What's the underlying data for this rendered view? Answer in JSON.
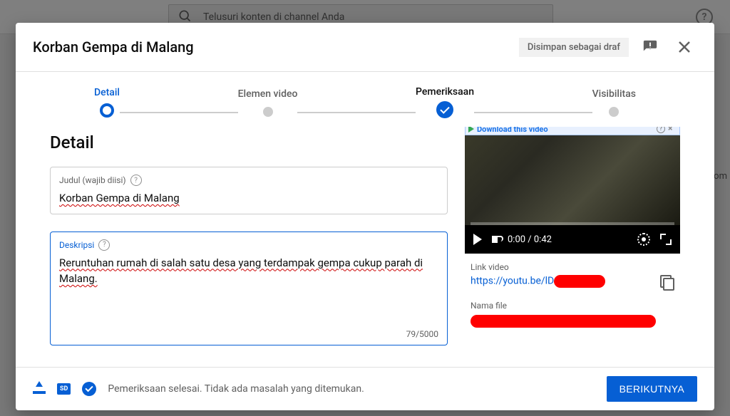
{
  "background": {
    "search_placeholder": "Telusuri konten di channel Anda",
    "sidebar_col": "Kom"
  },
  "modal": {
    "title": "Korban Gempa di Malang",
    "save_status": "Disimpan sebagai draf",
    "steps": {
      "detail": "Detail",
      "elemen": "Elemen video",
      "pemeriksaan": "Pemeriksaan",
      "visibilitas": "Visibilitas"
    },
    "section_title": "Detail",
    "title_field": {
      "label": "Judul (wajib diisi)",
      "value": "Korban Gempa di Malang"
    },
    "desc_field": {
      "label": "Deskripsi",
      "value": "Reruntuhan rumah di salah satu desa yang terdampak gempa cukup parah di Malang.",
      "counter": "79/5000"
    },
    "preview": {
      "download_label": "Download this video",
      "time": "0:00 / 0:42",
      "link_label": "Link video",
      "link_value": "https://youtu.be/lD",
      "file_label": "Nama file"
    },
    "footer": {
      "sd": "SD",
      "status": "Pemeriksaan selesai. Tidak ada masalah yang ditemukan.",
      "next": "BERIKUTNYA"
    }
  }
}
